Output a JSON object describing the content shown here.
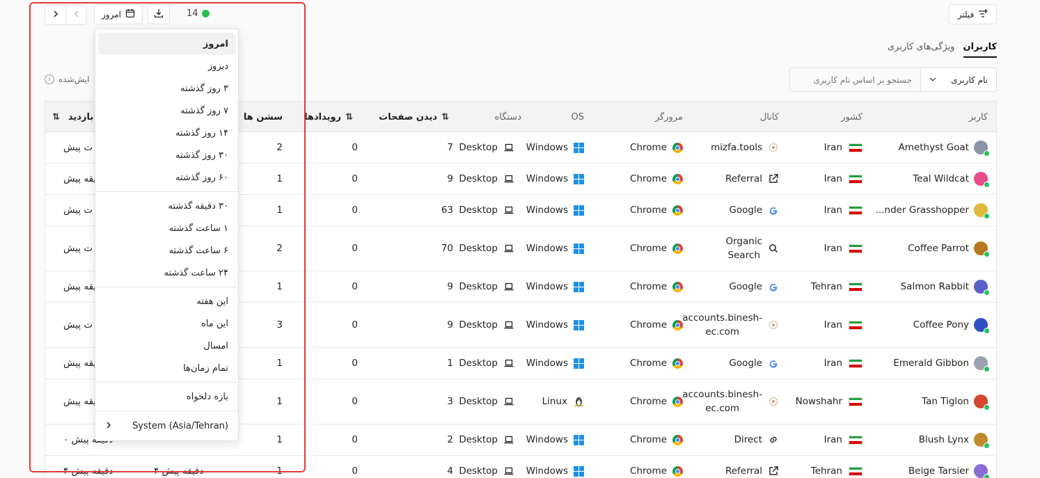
{
  "toolbar": {
    "filter_label": "فیلتر",
    "date_label": "امروز",
    "online_count": "14",
    "online_color": "#27c251"
  },
  "tabs": [
    {
      "label": "کاربران",
      "active": true
    },
    {
      "label": "ویژگی‌های کاربری",
      "active": false
    }
  ],
  "search": {
    "select_value": "نام کاربری",
    "placeholder": "جستجو بر اساس نام کاربری"
  },
  "shown_label": "نمایش‌داده شده",
  "shown_visible_fragment": "ایش‌شده",
  "table": {
    "headers": {
      "user": "کاربر",
      "country": "کشور",
      "channel": "کانال",
      "browser": "مرورگر",
      "os": "OS",
      "device": "دستگاه",
      "pageviews": "دیدن صفحات",
      "events": "رویدادها",
      "sessions": "سشن ها",
      "last_visit": "بازدید"
    },
    "rows": [
      {
        "name": "Amethyst Goat",
        "avatar_color": "#8b95a6",
        "country": "Iran",
        "channel": "mizfa.tools",
        "channel_icon": "site-icon",
        "browser": "Chrome",
        "os": "Windows",
        "os_icon": "windows-icon",
        "device": "Desktop",
        "pageviews": "7",
        "events": "0",
        "sessions": "2",
        "last_visit": "ت پیش"
      },
      {
        "name": "Teal Wildcat",
        "avatar_color": "#e84c8b",
        "country": "Iran",
        "channel": "Referral",
        "channel_icon": "external-link-icon",
        "browser": "Chrome",
        "os": "Windows",
        "os_icon": "windows-icon",
        "device": "Desktop",
        "pageviews": "9",
        "events": "0",
        "sessions": "1",
        "last_visit": "یقه پیش"
      },
      {
        "name": "...nder Grasshopper",
        "avatar_color": "#e2b93b",
        "country": "Iran",
        "channel": "Google",
        "channel_icon": "google-icon",
        "browser": "Chrome",
        "os": "Windows",
        "os_icon": "windows-icon",
        "device": "Desktop",
        "pageviews": "63",
        "events": "0",
        "sessions": "1",
        "last_visit": "ت پیش"
      },
      {
        "name": "Coffee Parrot",
        "avatar_color": "#b7791f",
        "country": "Iran",
        "channel": "Organic\nSearch",
        "channel_icon": "search-icon",
        "browser": "Chrome",
        "os": "Windows",
        "os_icon": "windows-icon",
        "device": "Desktop",
        "pageviews": "70",
        "events": "0",
        "sessions": "2",
        "last_visit": "ت پیش"
      },
      {
        "name": "Salmon Rabbit",
        "avatar_color": "#5b5fc7",
        "country": "Tehran",
        "channel": "Google",
        "channel_icon": "google-icon",
        "browser": "Chrome",
        "os": "Windows",
        "os_icon": "windows-icon",
        "device": "Desktop",
        "pageviews": "9",
        "events": "0",
        "sessions": "1",
        "last_visit": "یقه پیش"
      },
      {
        "name": "Coffee Pony",
        "avatar_color": "#2f4fbf",
        "country": "Iran",
        "channel": "accounts.binesh-\nec.com",
        "channel_icon": "site-icon",
        "browser": "Chrome",
        "os": "Windows",
        "os_icon": "windows-icon",
        "device": "Desktop",
        "pageviews": "9",
        "events": "0",
        "sessions": "3",
        "last_visit": "ت پیش"
      },
      {
        "name": "Emerald Gibbon",
        "avatar_color": "#9aa2ad",
        "country": "Iran",
        "channel": "Google",
        "channel_icon": "google-icon",
        "browser": "Chrome",
        "os": "Windows",
        "os_icon": "windows-icon",
        "device": "Desktop",
        "pageviews": "1",
        "events": "0",
        "sessions": "1",
        "last_visit": "یقه پیش"
      },
      {
        "name": "Tan Tiglon",
        "avatar_color": "#d4462f",
        "country": "Nowshahr",
        "channel": "accounts.binesh-\nec.com",
        "channel_icon": "site-icon",
        "browser": "Chrome",
        "os": "Linux",
        "os_icon": "linux-icon",
        "device": "Desktop",
        "pageviews": "3",
        "events": "0",
        "sessions": "1",
        "last_visit": "یقه پیش"
      },
      {
        "name": "Blush Lynx",
        "avatar_color": "#c08a2c",
        "country": "Iran",
        "channel": "Direct",
        "channel_icon": "link-icon",
        "browser": "Chrome",
        "os": "Windows",
        "os_icon": "windows-icon",
        "device": "Desktop",
        "pageviews": "2",
        "events": "0",
        "sessions": "1",
        "last_visit": "دقیقه پیش ۰"
      },
      {
        "name": "Beige Tarsier",
        "avatar_color": "#8a6bd6",
        "country": "Tehran",
        "channel": "Referral",
        "channel_icon": "external-link-icon",
        "browser": "Chrome",
        "os": "Windows",
        "os_icon": "windows-icon",
        "device": "Desktop",
        "pageviews": "4",
        "events": "0",
        "sessions": "1",
        "last_visit": "۴ دقیقه پیش",
        "extra": "۴ دقیقه پیش"
      }
    ]
  },
  "dropdown": {
    "groups": [
      [
        "امروز",
        "دیروز",
        "۳ روز گذشته",
        "۷ روز گذشته",
        "۱۴ روز گذشته",
        "۳۰ روز گذشته",
        "۶۰ روز گذشته"
      ],
      [
        "۳۰ دقیقه گذشته",
        "۱ ساعت گذشته",
        "۶ ساعت گذشته",
        "۲۴ ساعت گذشته"
      ],
      [
        "این هفته",
        "این ماه",
        "امسال",
        "تمام زمان‌ها"
      ],
      [
        "بازه دلخواه"
      ]
    ],
    "selected": "امروز",
    "timezone": "System (Asia/Tehran)"
  },
  "annotation_color": "#e53935"
}
